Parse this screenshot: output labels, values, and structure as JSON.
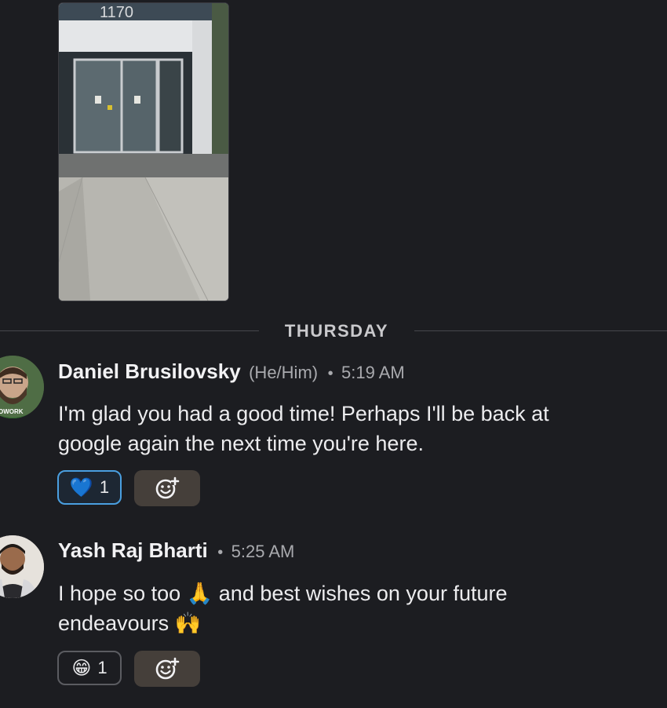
{
  "image_attachment": {
    "sign_text": "1170"
  },
  "divider": {
    "label": "THURSDAY"
  },
  "messages": [
    {
      "author": "Daniel Brusilovsky",
      "pronouns": "(He/Him)",
      "separator": "•",
      "time": "5:19 AM",
      "avatar_badge": "OWORK",
      "text_line1": "I'm glad you had a good time! Perhaps I'll be back at",
      "text_line2": "google again the next time you're here.",
      "reaction": {
        "emoji": "💙",
        "count": "1",
        "icon": "blue-heart-icon"
      },
      "add_reaction_icon": "add-reaction-smiley-icon"
    },
    {
      "author": "Yash Raj Bharti",
      "separator": "•",
      "time": "5:25 AM",
      "text_line1_a": "I hope so too",
      "emoji1": "🙏",
      "text_line1_b": "and best wishes on your future",
      "text_line2": "endeavours",
      "emoji2": "🙌",
      "reaction": {
        "emoji": "😁",
        "count": "1",
        "icon": "grinning-face-icon"
      },
      "add_reaction_icon": "add-reaction-smiley-icon"
    }
  ],
  "colors": {
    "background": "#1c1d21",
    "reaction_active_border": "#4a9fe0",
    "add_reaction_bg": "#453f3a"
  }
}
